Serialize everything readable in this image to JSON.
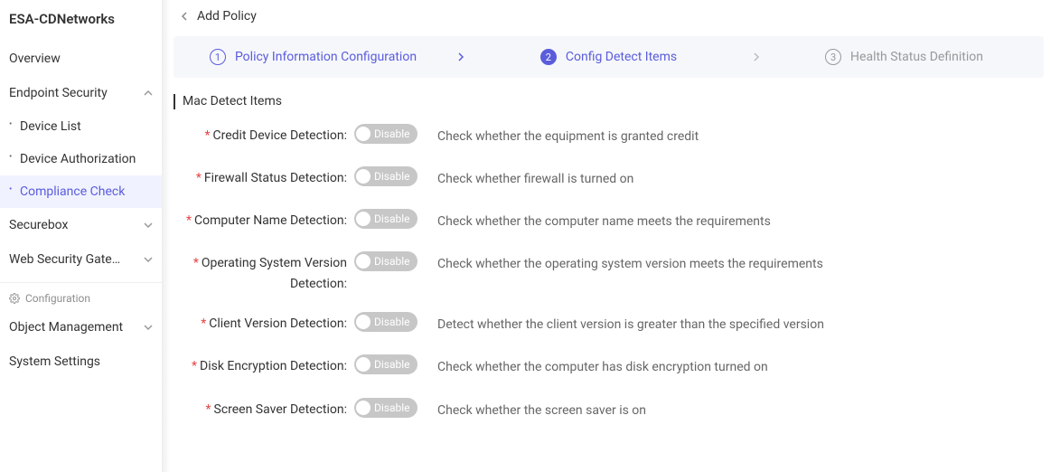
{
  "brand": "ESA-CDNetworks",
  "sidebar": {
    "overview": "Overview",
    "endpointSecurity": {
      "label": "Endpoint Security",
      "expanded": true
    },
    "deviceList": "Device List",
    "deviceAuthorization": "Device Authorization",
    "complianceCheck": "Compliance Check",
    "securebox": "Securebox",
    "webSecurityGateway": "Web Security Gatew...",
    "configuration": "Configuration",
    "objectManagement": "Object Management",
    "systemSettings": "System Settings"
  },
  "page": {
    "title": "Add Policy"
  },
  "steps": {
    "s1": {
      "num": "1",
      "label": "Policy Information Configuration"
    },
    "s2": {
      "num": "2",
      "label": "Config Detect Items"
    },
    "s3": {
      "num": "3",
      "label": "Health Status Definition"
    }
  },
  "section": {
    "title": "Mac Detect Items"
  },
  "toggle": {
    "disableLabel": "Disable"
  },
  "rows": {
    "credit": {
      "label": "Credit Device Detection:",
      "desc": "Check whether the equipment is granted credit"
    },
    "firewall": {
      "label": "Firewall Status Detection:",
      "desc": "Check whether firewall is turned on"
    },
    "computer": {
      "label": "Computer Name Detection:",
      "desc": "Check whether the computer name meets the requirements"
    },
    "os": {
      "label": "Operating System Version Detection:",
      "desc": "Check whether the operating system version meets the requirements"
    },
    "client": {
      "label": "Client Version Detection:",
      "desc": "Detect whether the client version is greater than the specified version"
    },
    "disk": {
      "label": "Disk Encryption Detection:",
      "desc": "Check whether the computer has disk encryption turned on"
    },
    "screen": {
      "label": "Screen Saver Detection:",
      "desc": "Check whether the screen saver is on"
    }
  }
}
